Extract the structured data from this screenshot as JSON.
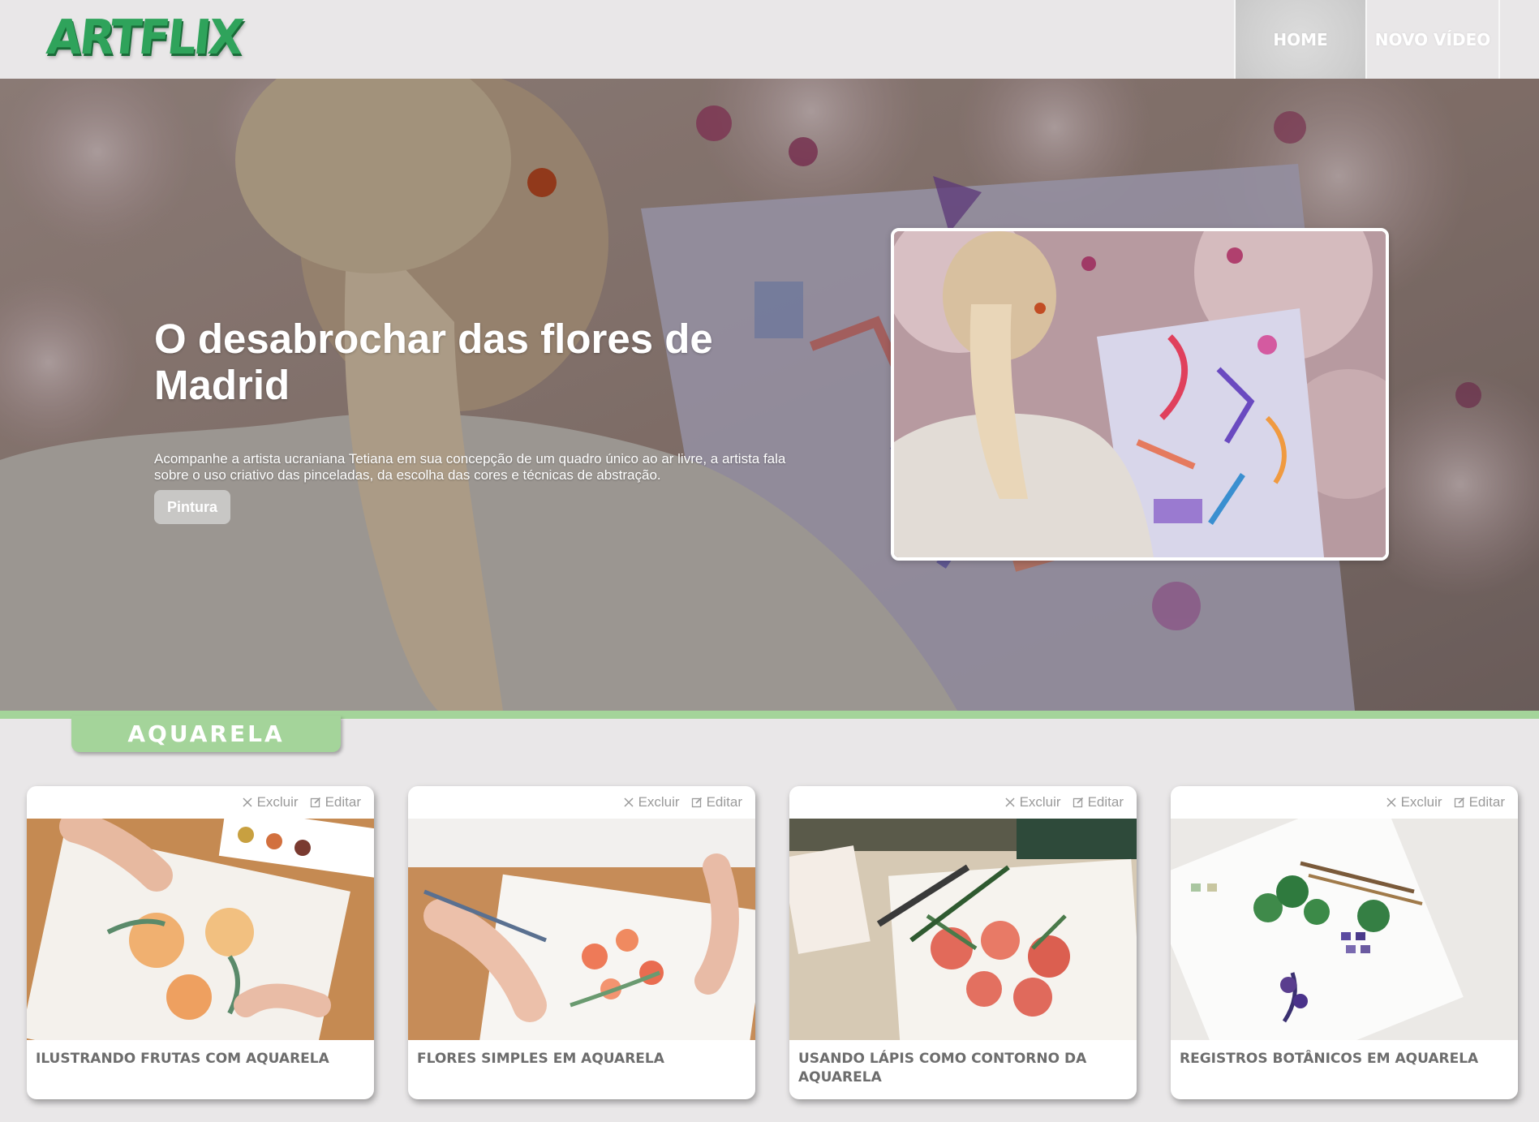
{
  "header": {
    "logo": "ARTFLIX",
    "nav": [
      {
        "label": "HOME",
        "active": true
      },
      {
        "label": "NOVO VÍDEO",
        "active": false
      }
    ]
  },
  "hero": {
    "title": "O desabrochar das flores de Madrid",
    "description": "Acompanhe a artista ucraniana Tetiana em sua concepção de um quadro único ao ar livre, a artista fala sobre o uso criativo das pinceladas, da escolha das cores e técnicas de abstração.",
    "tag": "Pintura"
  },
  "category": {
    "label": "AQUARELA",
    "color": "#a4d49a"
  },
  "cards": [
    {
      "title": "Ilustrando frutas com aquarela",
      "delete_label": "Excluir",
      "edit_label": "Editar"
    },
    {
      "title": "Flores simples em aquarela",
      "delete_label": "Excluir",
      "edit_label": "Editar"
    },
    {
      "title": "Usando lápis como contorno da aquarela",
      "delete_label": "Excluir",
      "edit_label": "Editar"
    },
    {
      "title": "Registros botânicos em aquarela",
      "delete_label": "Excluir",
      "edit_label": "Editar"
    }
  ],
  "colors": {
    "background": "#e9e7e8",
    "brand": "#2fa35b",
    "category": "#a4d49a",
    "card_text": "#6d6d6d"
  }
}
